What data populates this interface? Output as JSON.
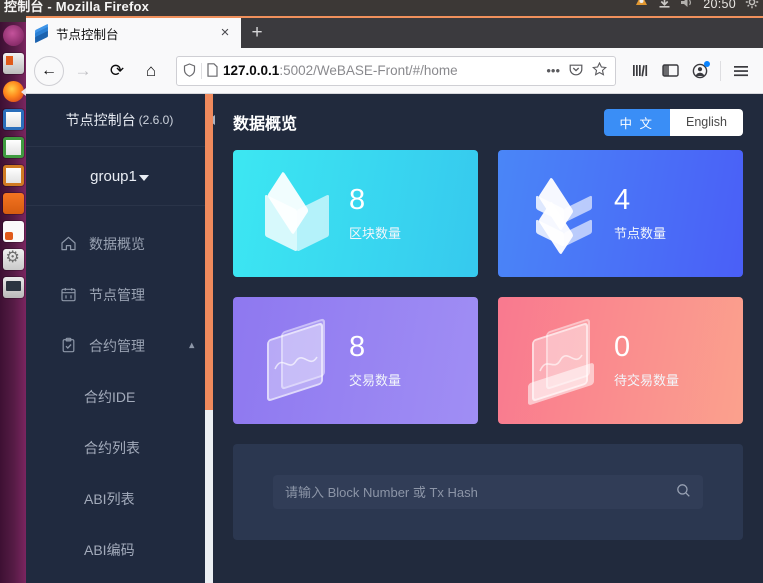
{
  "os": {
    "window_title": "控制台 - Mozilla Firefox",
    "tray": {
      "clock": "20:50",
      "icons": [
        "app-indicator-icon",
        "download-icon",
        "volume-icon",
        "settings-gear-icon"
      ]
    },
    "dock_items": [
      {
        "name": "ubuntu-dash",
        "style": "dk-ubuntu"
      },
      {
        "name": "files-manager",
        "style": "dk-files"
      },
      {
        "name": "firefox",
        "style": "dk-firefox",
        "active": true
      },
      {
        "name": "libreoffice-writer",
        "style": "dk-blue"
      },
      {
        "name": "libreoffice-calc",
        "style": "dk-green"
      },
      {
        "name": "libreoffice-impress",
        "style": "dk-orange2"
      },
      {
        "name": "ubuntu-software",
        "style": "dk-solid"
      },
      {
        "name": "help-document",
        "style": "dk-doc"
      },
      {
        "name": "system-settings",
        "style": "dk-tools"
      },
      {
        "name": "terminal",
        "style": "dk-screen"
      }
    ]
  },
  "browser": {
    "tab": {
      "title": "节点控制台",
      "favicon": "stacked-layers-icon",
      "close_label": "×"
    },
    "new_tab_label": "+",
    "nav": {
      "back_label": "←",
      "forward_label": "→",
      "reload_label": "⟳",
      "home_label": "⌂"
    },
    "url": {
      "host": "127.0.0.1",
      "rest": ":5002/WeBASE-Front/#/home",
      "page_action_label": "•••",
      "shield_icon": "tracking-protection-shield-icon",
      "page_icon": "page-info-icon",
      "pocket_icon": "pocket-icon",
      "bookmark_icon": "star-icon"
    },
    "toolbar_right": {
      "library_icon": "library-icon",
      "sidebar_icon": "sidebar-icon",
      "account_icon": "account-avatar-icon",
      "menu_icon": "hamburger-menu-icon"
    }
  },
  "sidebar": {
    "title": "节点控制台",
    "version": "(2.6.0)",
    "collapse_icon": "collapse-sidebar-arrow-icon",
    "group": {
      "label": "group1",
      "caret": "chevron-down-icon"
    },
    "items": [
      {
        "label": "数据概览",
        "icon": "home-icon",
        "level": "top"
      },
      {
        "label": "节点管理",
        "icon": "calendar-node-icon",
        "level": "top"
      },
      {
        "label": "合约管理",
        "icon": "clipboard-check-icon",
        "level": "top",
        "expanded": true
      },
      {
        "label": "合约IDE",
        "icon": "",
        "level": "sub"
      },
      {
        "label": "合约列表",
        "icon": "",
        "level": "sub"
      },
      {
        "label": "ABI列表",
        "icon": "",
        "level": "sub"
      },
      {
        "label": "ABI编码",
        "icon": "",
        "level": "sub"
      }
    ],
    "scrollbar_color": "#f08a5d"
  },
  "content": {
    "page_title": "数据概览",
    "language": {
      "active": "中 文",
      "inactive": "English",
      "active_color": "#3a8ef6"
    },
    "cards": [
      {
        "value": "8",
        "label": "区块数量",
        "icon": "cube-icon",
        "theme": "c-blocks",
        "color": "#3ce7f2"
      },
      {
        "value": "4",
        "label": "节点数量",
        "icon": "server-stack-icon",
        "theme": "c-nodes",
        "color": "#4a86f7"
      },
      {
        "value": "8",
        "label": "交易数量",
        "icon": "chart-panel-icon",
        "theme": "c-tx",
        "color": "#8e78f0"
      },
      {
        "value": "0",
        "label": "待交易数量",
        "icon": "pending-chart-icon",
        "theme": "c-pending",
        "color": "#f9798f"
      }
    ],
    "search": {
      "placeholder": "请输入 Block Number 或 Tx Hash",
      "value": "",
      "icon": "search-icon"
    }
  }
}
